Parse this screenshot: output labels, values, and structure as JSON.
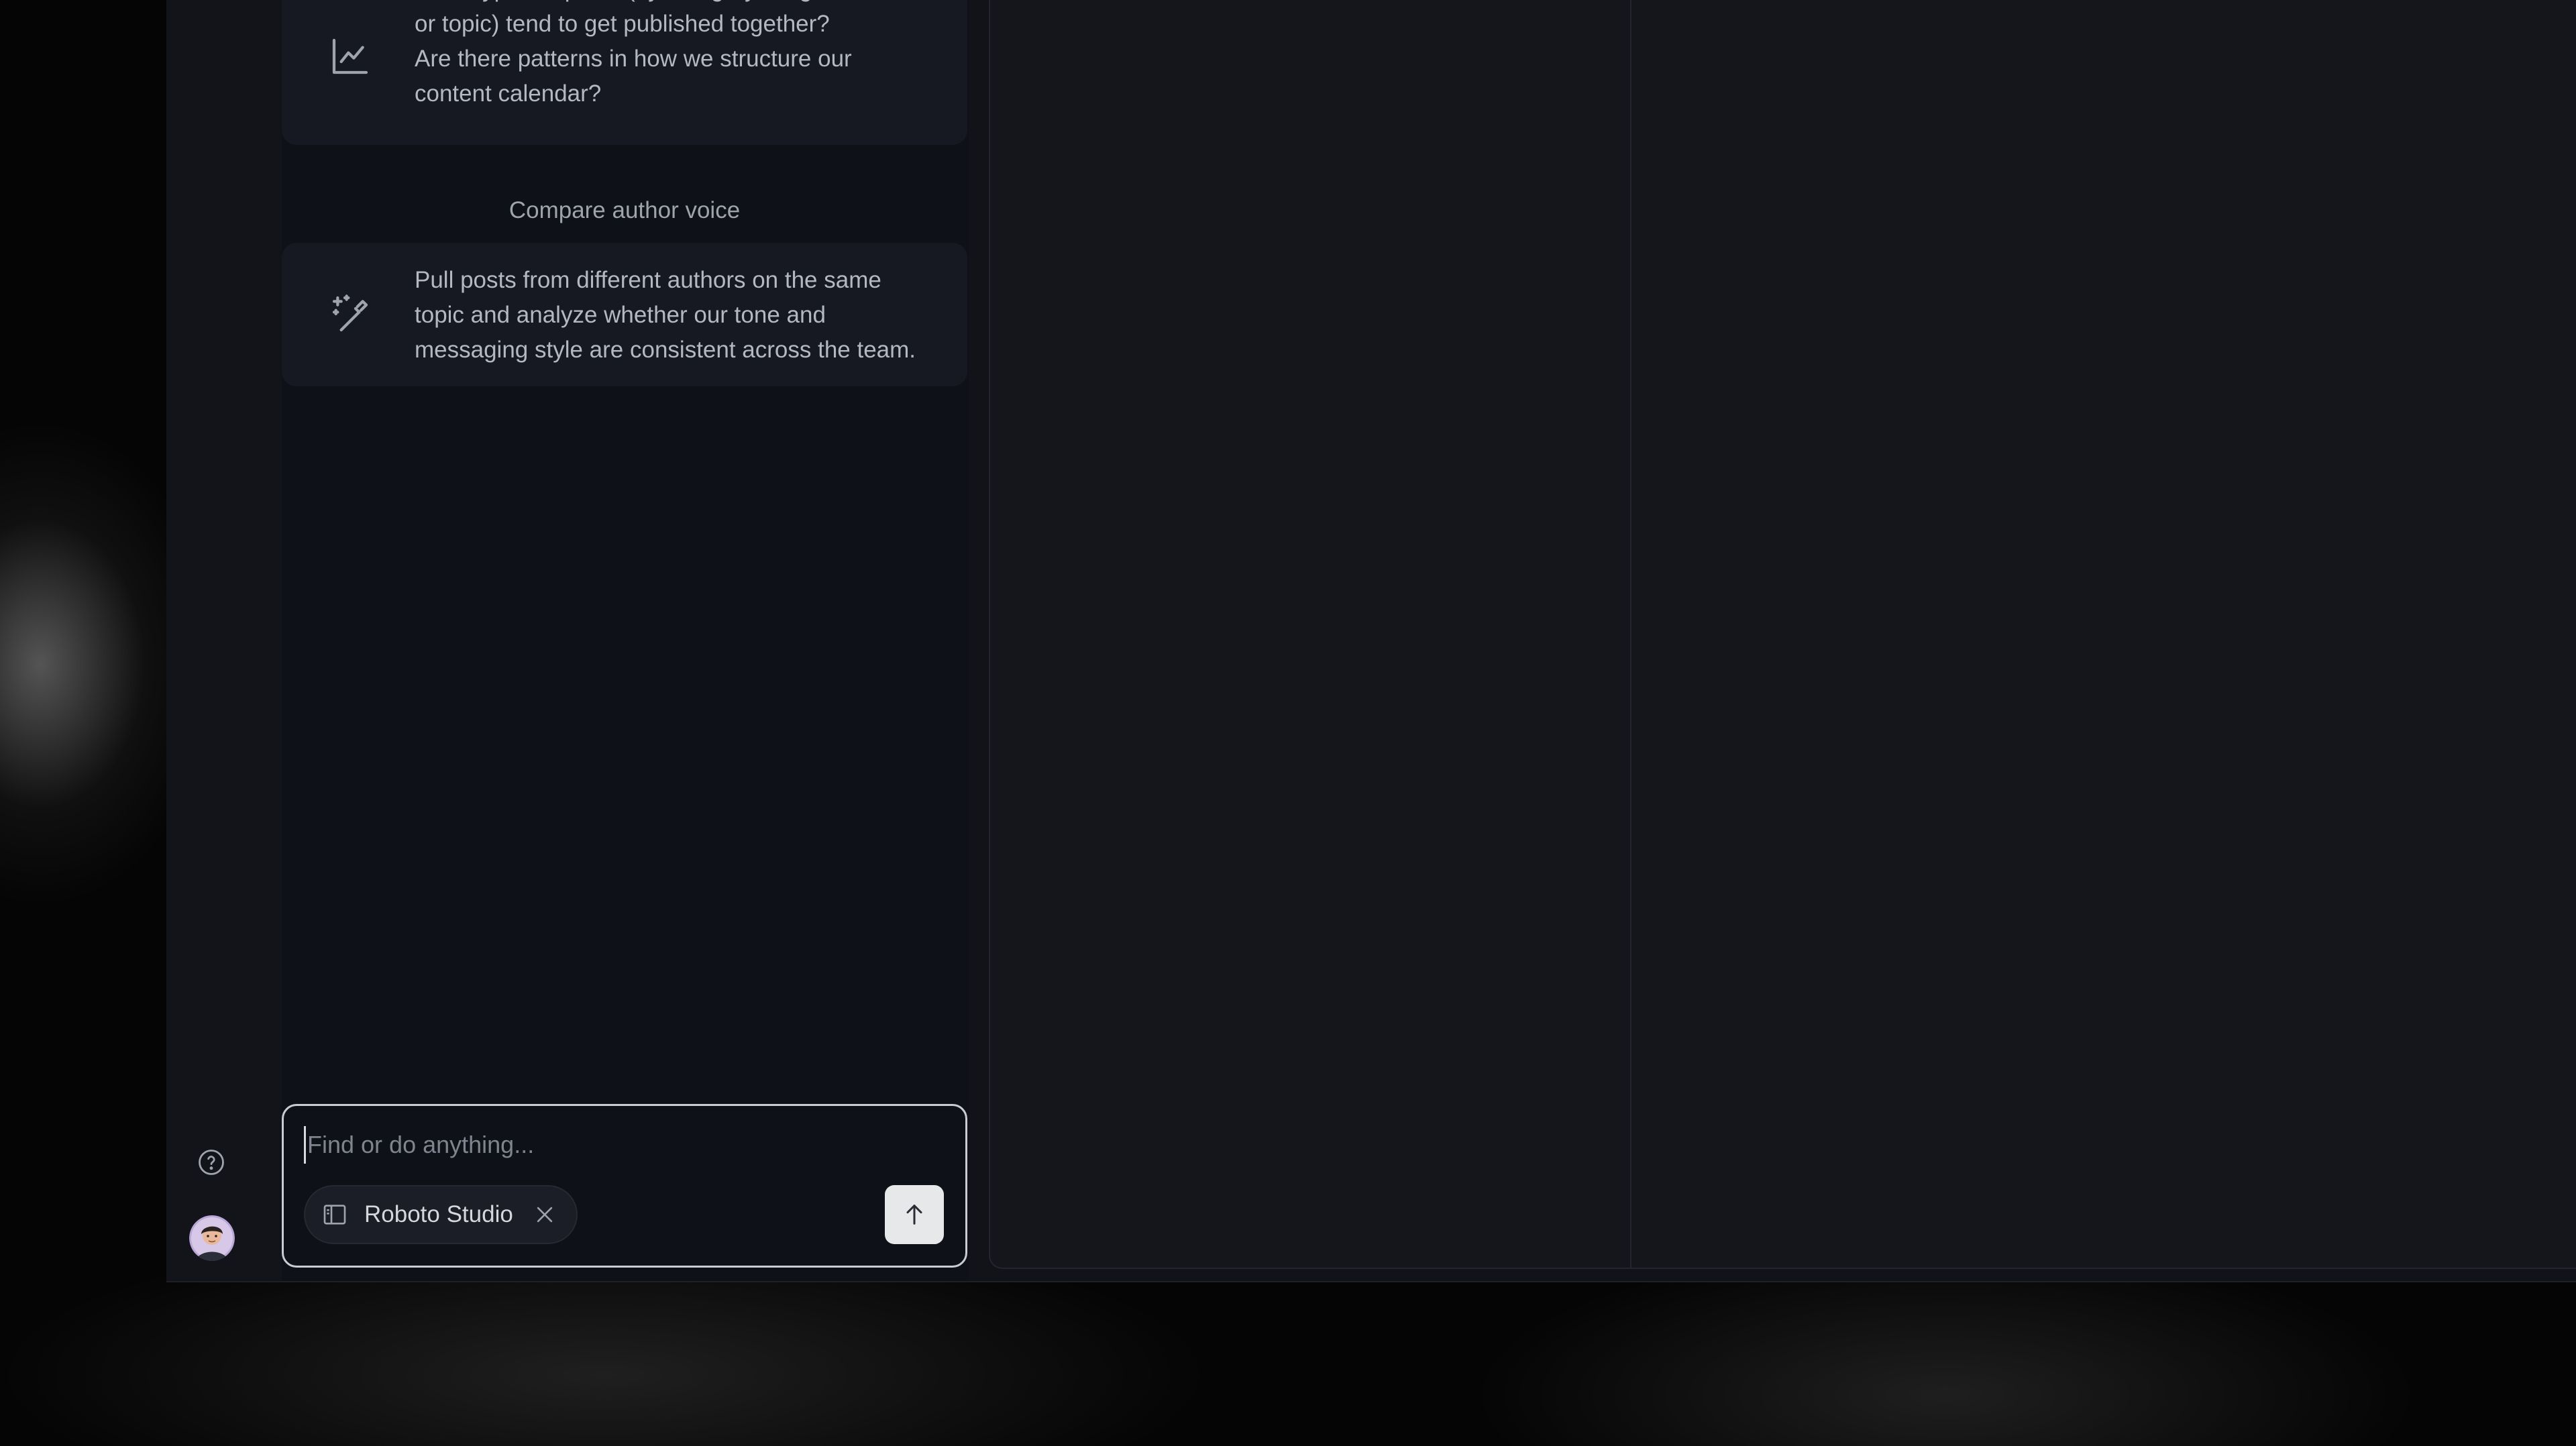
{
  "suggestions": {
    "items": [
      {
        "icon": "line-chart-icon",
        "lines": [
          "What types of posts (by category, length,",
          "or topic) tend to get published together?",
          "Are there patterns in how we structure our",
          "content calendar?"
        ]
      },
      {
        "heading": "Compare author voice",
        "icon": "magic-wand-icon",
        "lines": [
          "Pull posts from different authors on the same",
          "topic and analyze whether our tone and",
          "messaging style are consistent across the team."
        ]
      }
    ]
  },
  "rail": {
    "help_icon": "help-circle-icon",
    "avatar_icon": "user-avatar-icon"
  },
  "composer": {
    "placeholder": "Find or do anything...",
    "value": "",
    "context_chip": {
      "icon": "sidebar-panel-icon",
      "label": "Roboto Studio",
      "close_icon": "close-icon"
    },
    "send_icon": "arrow-up-icon"
  }
}
